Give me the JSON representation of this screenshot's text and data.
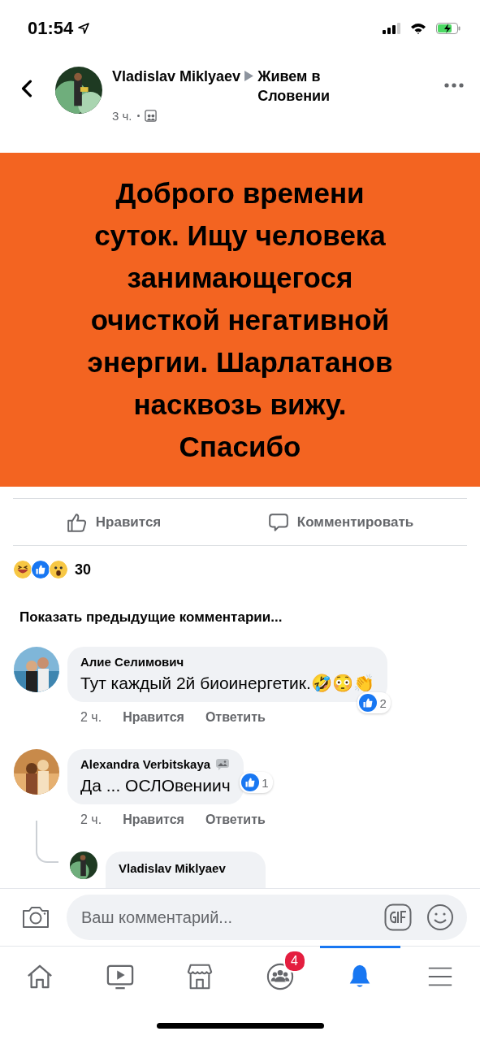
{
  "status_bar": {
    "time": "01:54"
  },
  "post": {
    "author": "Vladislav Miklyaev",
    "group": "Живем в Словении",
    "time": "3 ч.",
    "text": "Доброго времени суток. Ищу человека занимающегося очисткой негативной энергии. Шарлатанов насквозь вижу. Спасибо"
  },
  "actions": [
    {
      "kind": "like",
      "label": "Нравится"
    },
    {
      "kind": "comment",
      "label": "Комментировать"
    }
  ],
  "reactions": {
    "count": "30"
  },
  "show_previous": "Показать предыдущие комментарии...",
  "comments": [
    {
      "author": "Алие Селимович",
      "badge": false,
      "text": "Тут каждый 2й биоинергетик.🤣😳👏",
      "time": "2 ч.",
      "like": "Нравится",
      "reply": "Ответить",
      "likes": "2"
    },
    {
      "author": "Alexandra Verbitskaya",
      "badge": true,
      "text": "Да ...  ОСЛОвениич",
      "time": "2 ч.",
      "like": "Нравится",
      "reply": "Ответить",
      "likes": "1",
      "replies": [
        {
          "author": "Vladislav Miklyaev"
        }
      ]
    }
  ],
  "composer": {
    "placeholder": "Ваш комментарий..."
  },
  "tabs": [
    {
      "kind": "home",
      "selected": false
    },
    {
      "kind": "video",
      "selected": false
    },
    {
      "kind": "shop",
      "selected": false
    },
    {
      "kind": "groups",
      "selected": false,
      "badge": "4"
    },
    {
      "kind": "bell",
      "selected": true
    },
    {
      "kind": "menu",
      "selected": false
    }
  ]
}
